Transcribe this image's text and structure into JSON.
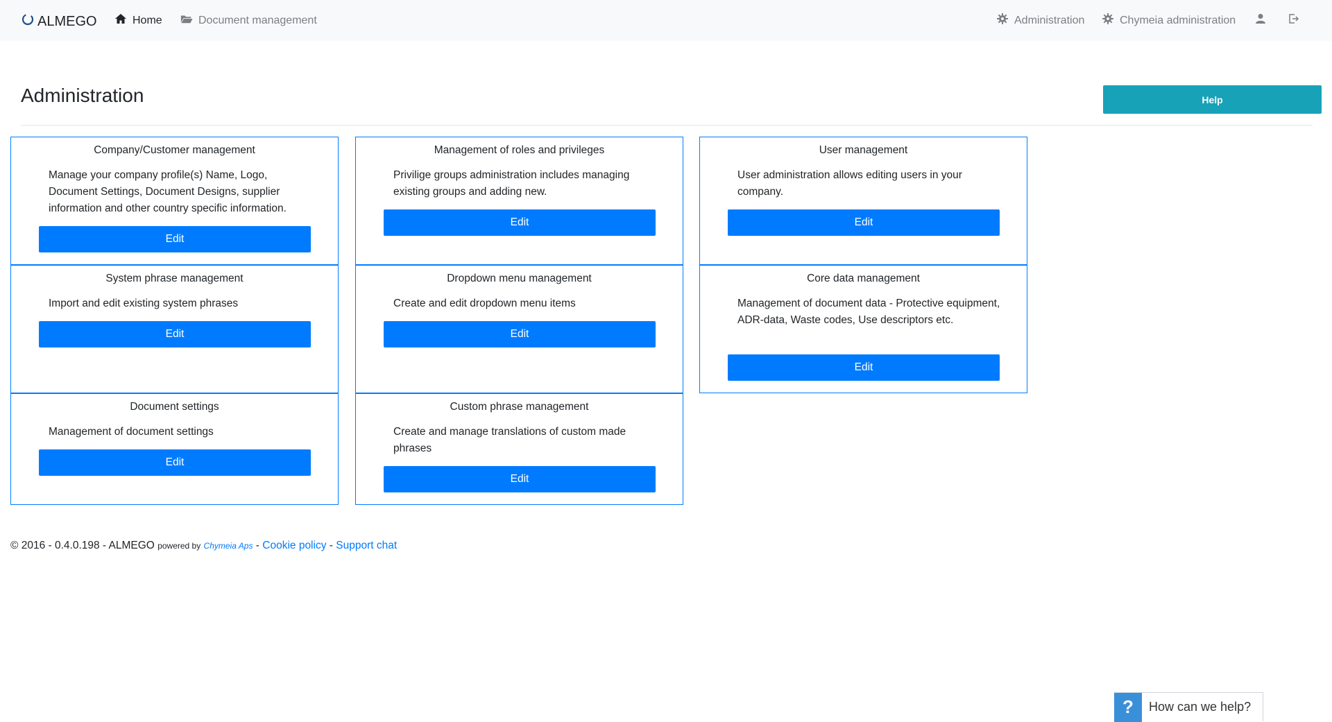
{
  "navbar": {
    "brand": "ALMEGO",
    "home": "Home",
    "document_management": "Document management",
    "administration": "Administration",
    "chymeia_administration": "Chymeia administration",
    "icons": {
      "brand": "almego-logo-icon",
      "home": "home-icon",
      "document": "folder-open-icon",
      "administration": "gear-icon",
      "chymeia": "gear-icon",
      "user": "user-icon",
      "logout": "logout-icon"
    }
  },
  "page": {
    "title": "Administration",
    "help_label": "Help"
  },
  "cards": [
    {
      "title": "Company/Customer management",
      "description": "Manage your company profile(s) Name, Logo, Document Settings, Document Designs, supplier information and other country specific information.",
      "button": "Edit"
    },
    {
      "title": "Management of roles and privileges",
      "description": "Privilige groups administration includes managing existing groups and adding new.",
      "button": "Edit"
    },
    {
      "title": "User management",
      "description": "User administration allows editing users in your company.",
      "button": "Edit"
    },
    {
      "title": "System phrase management",
      "description": "Import and edit existing system phrases",
      "button": "Edit"
    },
    {
      "title": "Dropdown menu management",
      "description": "Create and edit dropdown menu items",
      "button": "Edit"
    },
    {
      "title": "Core data management",
      "description": "Management of document data - Protective equipment, ADR-data, Waste codes, Use descriptors etc.",
      "button": "Edit"
    },
    {
      "title": "Document settings",
      "description": "Management of document settings",
      "button": "Edit"
    },
    {
      "title": "Custom phrase management",
      "description": "Create and manage translations of custom made phrases",
      "button": "Edit"
    }
  ],
  "footer": {
    "copyright": "© 2016 - 0.4.0.198 - ALMEGO",
    "powered_by": "powered by",
    "company": "Chymeia Aps",
    "sep1": "-",
    "cookie_policy": "Cookie policy",
    "sep2": "-",
    "support_chat": "Support chat"
  },
  "help_widget": {
    "icon": "?",
    "label": "How can we help?"
  },
  "colors": {
    "primary": "#007bff",
    "help": "#17a2b8",
    "navbar_bg": "#f8f9fa",
    "widget_icon": "#3a8fd9"
  }
}
